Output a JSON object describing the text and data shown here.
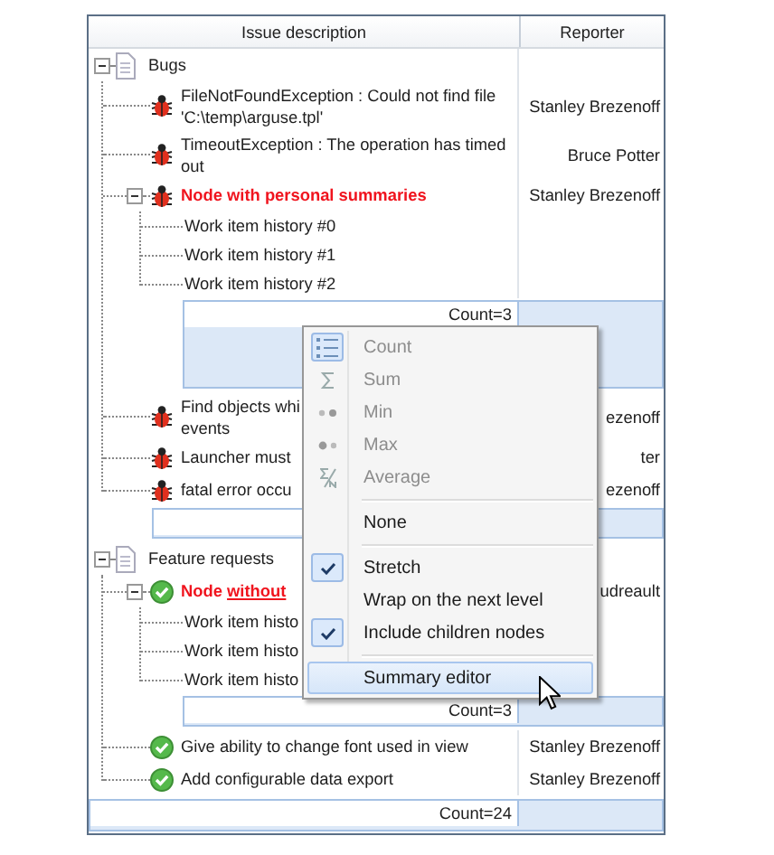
{
  "columns": [
    {
      "label": "Issue description"
    },
    {
      "label": "Reporter"
    }
  ],
  "tree": [
    {
      "kind": "group",
      "label": "Bugs",
      "expanded": true,
      "footer": true,
      "children": [
        {
          "kind": "bug",
          "label": "FileNotFoundException : Could not find file",
          "continuation": "'C:\\temp\\arguse.tpl'",
          "reporter": "Stanley Brezenoff"
        },
        {
          "kind": "bug",
          "label": "TimeoutException : The operation has timed",
          "continuation": "out",
          "reporter": "Bruce Potter"
        },
        {
          "kind": "bug",
          "label": "Node with personal summaries",
          "emphasis": true,
          "expanded": true,
          "reporter": "Stanley Brezenoff",
          "summary": {
            "text": "Count=3",
            "stretch": true
          },
          "children": [
            {
              "kind": "history",
              "label": "Work item history #0"
            },
            {
              "kind": "history",
              "label": "Work item history #1"
            },
            {
              "kind": "history",
              "label": "Work item history #2"
            }
          ]
        },
        {
          "kind": "bug",
          "label": "Find objects whi",
          "continuation": "events",
          "reporter": "ezenoff"
        },
        {
          "kind": "bug",
          "label": "Launcher must",
          "reporter": "ter"
        },
        {
          "kind": "bug",
          "label": "fatal error occu",
          "reporter": "ezenoff"
        }
      ]
    },
    {
      "kind": "group",
      "label": "Feature requests",
      "expanded": true,
      "children": [
        {
          "kind": "feature",
          "label": "Node",
          "underlined_part": "without",
          "emphasis": true,
          "expanded": true,
          "reporter": "udreault",
          "summary": {
            "text": "Count=3",
            "stretch": false
          },
          "children": [
            {
              "kind": "history",
              "label": "Work item histo"
            },
            {
              "kind": "history",
              "label": "Work item histo"
            },
            {
              "kind": "history",
              "label": "Work item histo"
            }
          ]
        },
        {
          "kind": "feature",
          "label": "Give ability to change font used in view",
          "reporter": "Stanley Brezenoff"
        },
        {
          "kind": "feature",
          "label": "Add configurable data export",
          "reporter": "Stanley Brezenoff"
        }
      ]
    }
  ],
  "grand_total": "Count=24",
  "menu": {
    "items": [
      {
        "kind": "aggregate",
        "label": "Count",
        "disabled": true,
        "selected": true
      },
      {
        "kind": "aggregate",
        "label": "Sum",
        "disabled": true,
        "selected": false
      },
      {
        "kind": "aggregate",
        "label": "Min",
        "disabled": true,
        "selected": false
      },
      {
        "kind": "aggregate",
        "label": "Max",
        "disabled": true,
        "selected": false
      },
      {
        "kind": "aggregate",
        "label": "Average",
        "disabled": true,
        "selected": false
      },
      {
        "kind": "separator"
      },
      {
        "kind": "action",
        "label": "None",
        "highlighted": false
      },
      {
        "kind": "separator"
      },
      {
        "kind": "option",
        "label": "Stretch",
        "checked": true
      },
      {
        "kind": "option",
        "label": "Wrap on the next level",
        "checked": false
      },
      {
        "kind": "option",
        "label": "Include children nodes",
        "checked": true
      },
      {
        "kind": "separator"
      },
      {
        "kind": "action",
        "label": "Summary editor",
        "highlighted": true
      }
    ]
  }
}
